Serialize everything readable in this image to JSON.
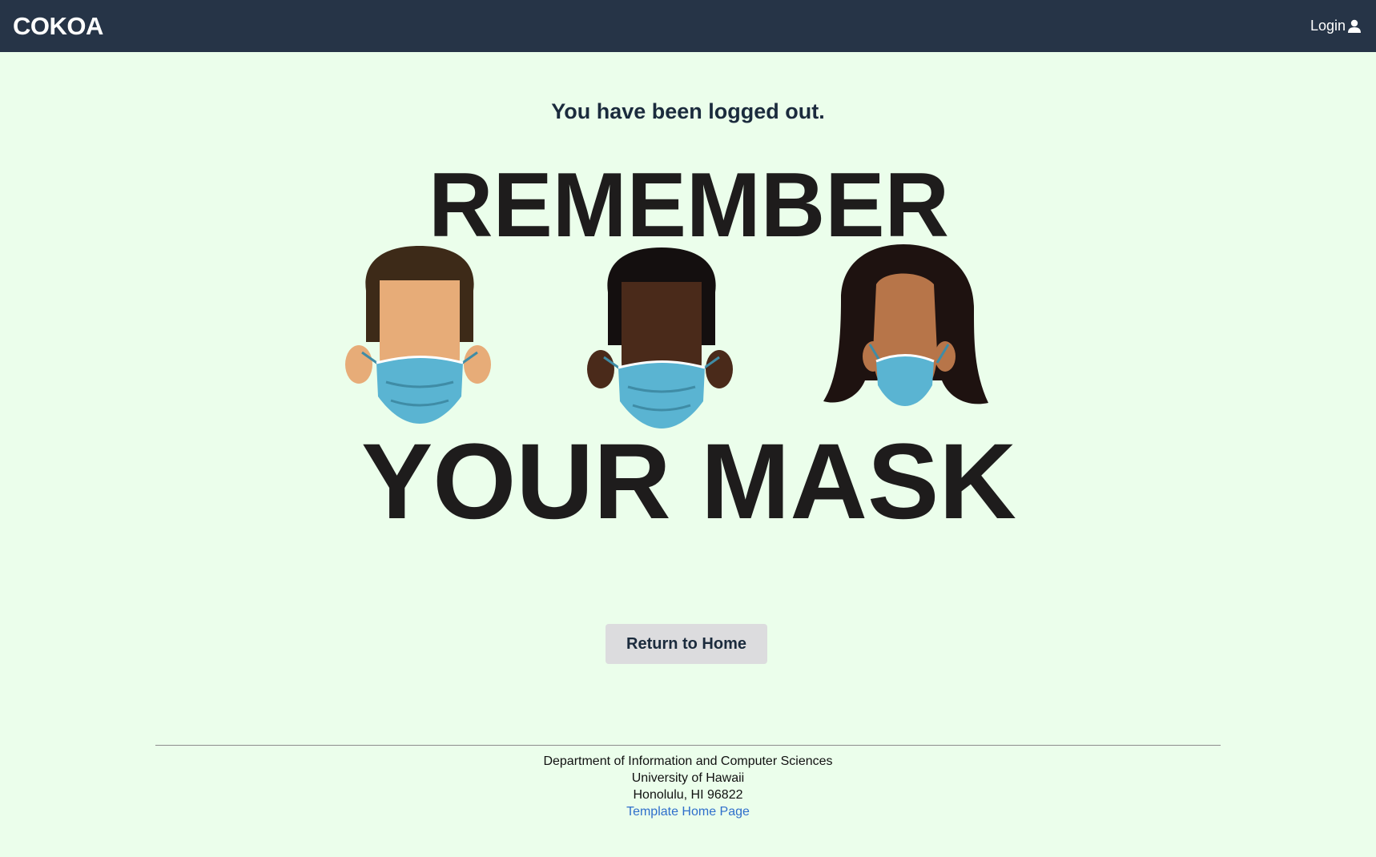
{
  "navbar": {
    "brand": "COKOA",
    "login_label": "Login",
    "login_icon": "user-icon"
  },
  "main": {
    "message": "You have been logged out.",
    "poster": {
      "line1": "REMEMBER",
      "line2": "YOUR MASK"
    },
    "return_button": "Return to Home"
  },
  "footer": {
    "line1": "Department of Information and Computer Sciences",
    "line2": "University of Hawaii",
    "line3": "Honolulu, HI 96822",
    "link": "Template Home Page"
  },
  "colors": {
    "navbar_bg": "#263447",
    "page_bg": "#ebfeeb",
    "mask": "#5ab4d2",
    "link": "#2f6fcb"
  }
}
